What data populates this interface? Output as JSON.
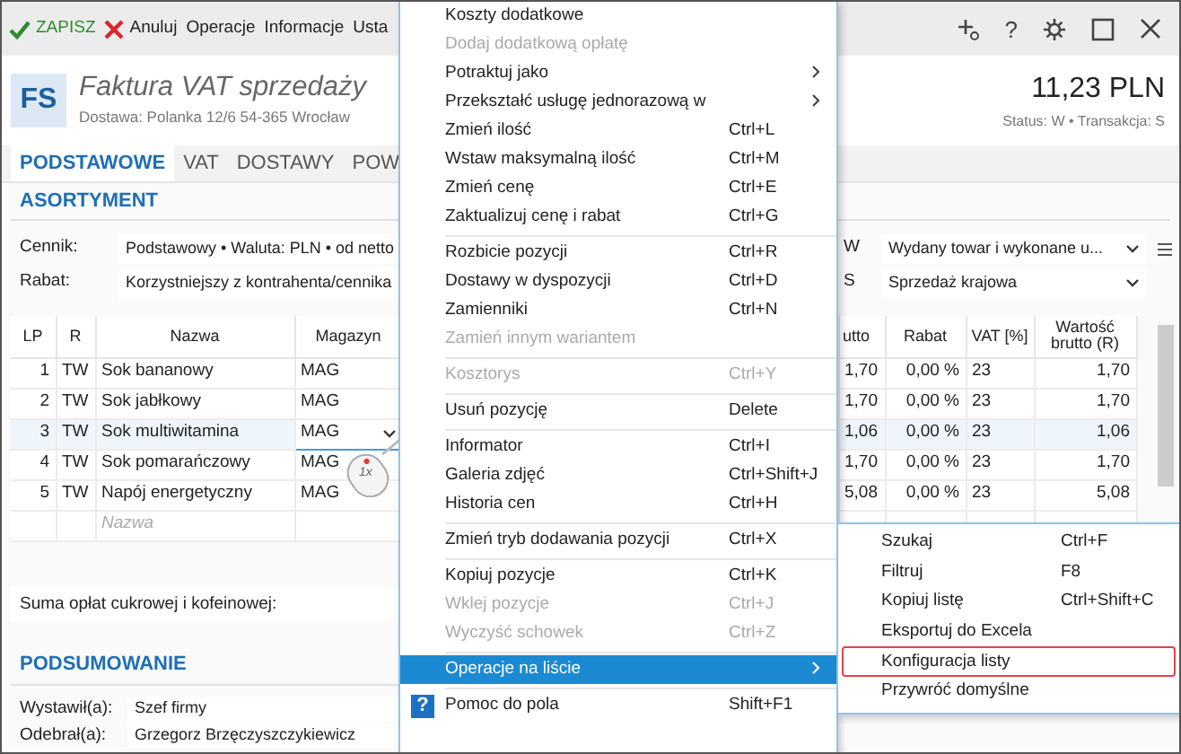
{
  "toolbar": {
    "buttons": [
      {
        "label": "ZAPISZ",
        "kind": "save"
      },
      {
        "label": "Anuluj",
        "kind": "cancel"
      },
      {
        "label": "Operacje",
        "kind": "plain"
      },
      {
        "label": "Informacje",
        "kind": "plain"
      },
      {
        "label": "Usta",
        "kind": "plain"
      }
    ],
    "help_glyph": "?"
  },
  "header": {
    "badge": "FS",
    "title": "Faktura VAT sprzedaży",
    "subtitle": "Dostawa: Polanka  12/6  54-365 Wrocław",
    "amount": "11,23 PLN",
    "status": "Status:  W  •  Transakcja:  S"
  },
  "tabs": [
    {
      "label": "PODSTAWOWE",
      "selected": true
    },
    {
      "label": "VAT",
      "selected": false
    },
    {
      "label": "DOSTAWY",
      "selected": false
    },
    {
      "label": "POW",
      "selected": false
    }
  ],
  "assortment": {
    "title": "ASORTYMENT",
    "fields": [
      {
        "label": "Cennik:",
        "value": "Podstawowy • Waluta: PLN • od netto",
        "code": "W",
        "option": "Wydany towar i wykonane u..."
      },
      {
        "label": "Rabat:",
        "value": "Korzystniejszy z kontrahenta/cennika",
        "code": "S",
        "option": "Sprzedaż krajowa"
      }
    ],
    "table": {
      "columns": [
        "LP",
        "R",
        "Nazwa",
        "Magazyn",
        "utto",
        "Rabat",
        "VAT [%]",
        "Wartość brutto (R)"
      ],
      "rows": [
        {
          "lp": "1",
          "r": "TW",
          "name": "Sok bananowy",
          "warehouse": "MAG",
          "price": "1,70",
          "discount": "0,00 %",
          "vat": "23",
          "gross": "1,70",
          "selected": false
        },
        {
          "lp": "2",
          "r": "TW",
          "name": "Sok jabłkowy",
          "warehouse": "MAG",
          "price": "1,70",
          "discount": "0,00 %",
          "vat": "23",
          "gross": "1,70",
          "selected": false
        },
        {
          "lp": "3",
          "r": "TW",
          "name": "Sok multiwitamina",
          "warehouse": "MAG",
          "price": "1,06",
          "discount": "0,00 %",
          "vat": "23",
          "gross": "1,06",
          "selected": true
        },
        {
          "lp": "4",
          "r": "TW",
          "name": "Sok pomarańczowy",
          "warehouse": "MAG",
          "price": "1,70",
          "discount": "0,00 %",
          "vat": "23",
          "gross": "1,70",
          "selected": false
        },
        {
          "lp": "5",
          "r": "TW",
          "name": "Napój energetyczny",
          "warehouse": "MAG",
          "price": "5,08",
          "discount": "0,00 %",
          "vat": "23",
          "gross": "5,08",
          "selected": false
        }
      ],
      "new_row_placeholder": "Nazwa"
    },
    "fees_label": "Suma opłat cukrowej i kofeinowej:"
  },
  "summary": {
    "title": "PODSUMOWANIE",
    "fields": [
      {
        "label": "Wystawił(a):",
        "value": "Szef firmy"
      },
      {
        "label": "Odebrał(a):",
        "value": "Grzegorz Brzęczyszczykiewicz"
      }
    ]
  },
  "cursor": {
    "label": "1x"
  },
  "context_menu": {
    "items": [
      {
        "kind": "item",
        "label": "Koszty dodatkowe",
        "disabled": false,
        "submenu": false,
        "selected": false
      },
      {
        "kind": "item",
        "label": "Dodaj dodatkową opłatę",
        "disabled": true,
        "submenu": false,
        "selected": false
      },
      {
        "kind": "item",
        "label": "Potraktuj jako",
        "disabled": false,
        "submenu": true,
        "selected": false
      },
      {
        "kind": "item",
        "label": "Przekształć usługę jednorazową w",
        "disabled": false,
        "submenu": true,
        "selected": false
      },
      {
        "kind": "item",
        "label": "Zmień ilość",
        "shortcut": "Ctrl+L",
        "disabled": false,
        "submenu": false,
        "selected": false
      },
      {
        "kind": "item",
        "label": "Wstaw maksymalną ilość",
        "shortcut": "Ctrl+M",
        "disabled": false,
        "submenu": false,
        "selected": false
      },
      {
        "kind": "item",
        "label": "Zmień cenę",
        "shortcut": "Ctrl+E",
        "disabled": false,
        "submenu": false,
        "selected": false
      },
      {
        "kind": "item",
        "label": "Zaktualizuj cenę i rabat",
        "shortcut": "Ctrl+G",
        "disabled": false,
        "submenu": false,
        "selected": false
      },
      {
        "kind": "separator"
      },
      {
        "kind": "item",
        "label": "Rozbicie pozycji",
        "shortcut": "Ctrl+R",
        "disabled": false,
        "submenu": false,
        "selected": false
      },
      {
        "kind": "item",
        "label": "Dostawy w dyspozycji",
        "shortcut": "Ctrl+D",
        "disabled": false,
        "submenu": false,
        "selected": false
      },
      {
        "kind": "item",
        "label": "Zamienniki",
        "shortcut": "Ctrl+N",
        "disabled": false,
        "submenu": false,
        "selected": false
      },
      {
        "kind": "item",
        "label": "Zamień innym wariantem",
        "disabled": true,
        "submenu": false,
        "selected": false
      },
      {
        "kind": "separator"
      },
      {
        "kind": "item",
        "label": "Kosztorys",
        "shortcut": "Ctrl+Y",
        "disabled": true,
        "submenu": false,
        "selected": false
      },
      {
        "kind": "separator"
      },
      {
        "kind": "item",
        "label": "Usuń pozycję",
        "shortcut": "Delete",
        "disabled": false,
        "submenu": false,
        "selected": false
      },
      {
        "kind": "separator"
      },
      {
        "kind": "item",
        "label": "Informator",
        "shortcut": "Ctrl+I",
        "disabled": false,
        "submenu": false,
        "selected": false
      },
      {
        "kind": "item",
        "label": "Galeria zdjęć",
        "shortcut": "Ctrl+Shift+J",
        "disabled": false,
        "submenu": false,
        "selected": false
      },
      {
        "kind": "item",
        "label": "Historia cen",
        "shortcut": "Ctrl+H",
        "disabled": false,
        "submenu": false,
        "selected": false
      },
      {
        "kind": "separator"
      },
      {
        "kind": "item",
        "label": "Zmień tryb dodawania pozycji",
        "shortcut": "Ctrl+X",
        "disabled": false,
        "submenu": false,
        "selected": false
      },
      {
        "kind": "separator"
      },
      {
        "kind": "item",
        "label": "Kopiuj pozycje",
        "shortcut": "Ctrl+K",
        "disabled": false,
        "submenu": false,
        "selected": false
      },
      {
        "kind": "item",
        "label": "Wklej pozycje",
        "shortcut": "Ctrl+J",
        "disabled": true,
        "submenu": false,
        "selected": false
      },
      {
        "kind": "item",
        "label": "Wyczyść schowek",
        "shortcut": "Ctrl+Z",
        "disabled": true,
        "submenu": false,
        "selected": false
      },
      {
        "kind": "separator"
      },
      {
        "kind": "item",
        "label": "Operacje na liście",
        "disabled": false,
        "submenu": true,
        "selected": true
      },
      {
        "kind": "separator"
      },
      {
        "kind": "help",
        "label": "Pomoc do pola",
        "shortcut": "Shift+F1",
        "glyph": "?",
        "disabled": false,
        "submenu": false,
        "selected": false
      }
    ]
  },
  "submenu": {
    "items": [
      {
        "label": "Szukaj",
        "shortcut": "Ctrl+F",
        "highlighted": false
      },
      {
        "label": "Filtruj",
        "shortcut": "F8",
        "highlighted": false
      },
      {
        "label": "Kopiuj listę",
        "shortcut": "Ctrl+Shift+C",
        "highlighted": false
      },
      {
        "label": "Eksportuj do Excela",
        "highlighted": false
      },
      {
        "label": "Konfiguracja listy",
        "highlighted": true
      },
      {
        "label": "Przywróć domyślne",
        "highlighted": false
      }
    ]
  }
}
